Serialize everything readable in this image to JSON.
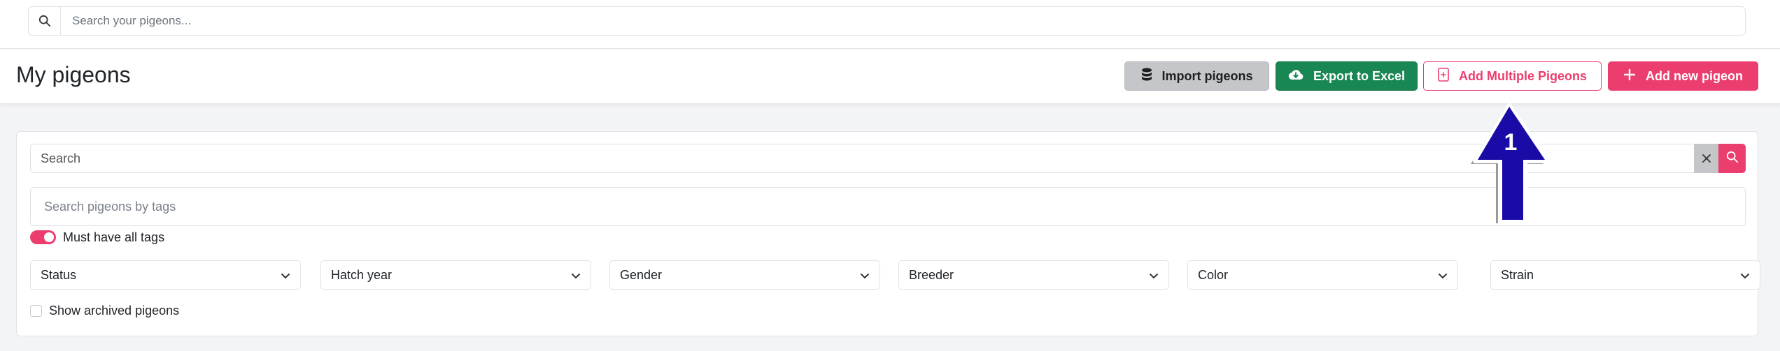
{
  "topbar": {
    "search_placeholder": "Search your pigeons..."
  },
  "header": {
    "title": "My pigeons",
    "buttons": {
      "import": "Import pigeons",
      "export": "Export to Excel",
      "add_multiple": "Add Multiple Pigeons",
      "add_new": "Add new pigeon"
    }
  },
  "filters": {
    "search_placeholder": "Search",
    "tags_placeholder": "Search pigeons by tags",
    "must_have_all_tags": "Must have all tags",
    "selects": [
      "Status",
      "Hatch year",
      "Gender",
      "Breeder",
      "Color",
      "Strain"
    ],
    "show_archived": "Show archived pigeons"
  },
  "annotation": {
    "number": "1"
  },
  "colors": {
    "accent": "#ec3e6e",
    "export_green": "#198754",
    "import_gray": "#c4c6c9",
    "arrow_blue": "#1a0aa6"
  },
  "icons": {
    "top_search": "search-icon",
    "import": "database-icon",
    "export": "cloud-download-icon",
    "add_multiple": "file-plus-icon",
    "add_new": "plus-icon",
    "clear": "close-icon",
    "search": "search-icon",
    "select": "chevron-down-icon"
  }
}
